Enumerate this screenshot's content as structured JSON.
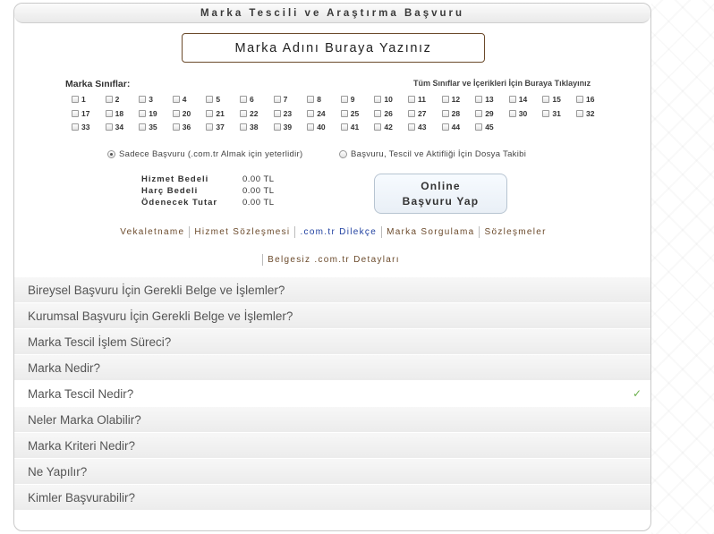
{
  "title": "Marka Tescili ve Araştırma Başvuru",
  "name_input": {
    "placeholder": "Marka Adını Buraya Yazınız"
  },
  "classes_label": "Marka Sınıflar:",
  "all_classes_link": "Tüm Sınıflar ve İçerikleri İçin Buraya Tıklayınız",
  "classes": [
    "1",
    "2",
    "3",
    "4",
    "5",
    "6",
    "7",
    "8",
    "9",
    "10",
    "11",
    "12",
    "13",
    "14",
    "15",
    "16",
    "17",
    "18",
    "19",
    "20",
    "21",
    "22",
    "23",
    "24",
    "25",
    "26",
    "27",
    "28",
    "29",
    "30",
    "31",
    "32",
    "33",
    "34",
    "35",
    "36",
    "37",
    "38",
    "39",
    "40",
    "41",
    "42",
    "43",
    "44",
    "45"
  ],
  "options": {
    "basic": "Sadece Başvuru (.com.tr Almak için yeterlidir)",
    "full": "Başvuru, Tescil ve Aktifliği İçin Dosya Takibi"
  },
  "fees": [
    {
      "label": "Hizmet Bedeli",
      "value": "0.00 TL"
    },
    {
      "label": "Harç Bedeli",
      "value": "0.00 TL"
    },
    {
      "label": "Ödenecek Tutar",
      "value": "0.00 TL"
    }
  ],
  "apply_button": {
    "line1": "Online",
    "line2": "Başvuru Yap"
  },
  "links": {
    "vekaletname": "Vekaletname",
    "hizmet": "Hizmet Sözleşmesi",
    "dilekce": ".com.tr Dilekçe",
    "sorgulama": "Marka Sorgulama",
    "sozlesmeler": "Sözleşmeler",
    "belgesiz": "Belgesiz .com.tr Detayları"
  },
  "faq": [
    "Bireysel Başvuru İçin Gerekli Belge ve İşlemler?",
    "Kurumsal Başvuru İçin Gerekli Belge ve İşlemler?",
    "Marka Tescil İşlem Süreci?",
    "Marka Nedir?",
    "Marka Tescil Nedir?",
    "Neler Marka Olabilir?",
    "Marka Kriteri Nedir?",
    "Ne Yapılır?",
    "Kimler Başvurabilir?"
  ],
  "check_icon": "checkmark-icon",
  "accent_color": "#6b4a2b",
  "check_color": "#6ab04c"
}
